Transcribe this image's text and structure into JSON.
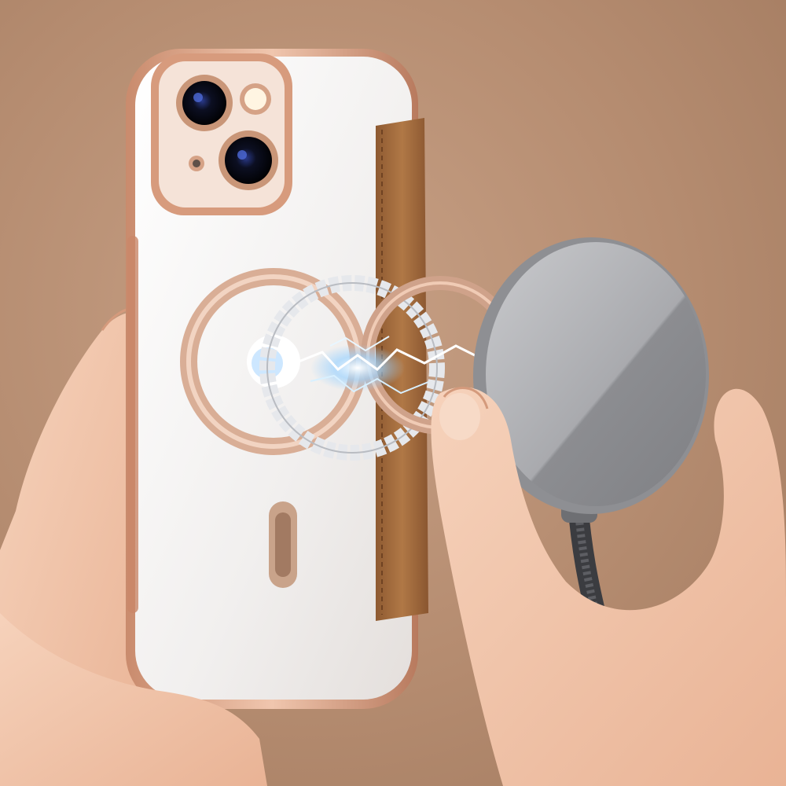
{
  "scene": {
    "subject": "phone-case-with-magsafe-charger",
    "colors": {
      "background": "#b58c70",
      "case_rim": "#d9a88e",
      "case_rim_dark": "#b87c62",
      "leather_flap": "#a26a3e",
      "charger_disc": "#9c9da1",
      "skin": "#f2c4a8"
    },
    "icons": [
      "camera-lens-icon",
      "magnet-ring-icon",
      "lightning-spark-icon"
    ]
  }
}
